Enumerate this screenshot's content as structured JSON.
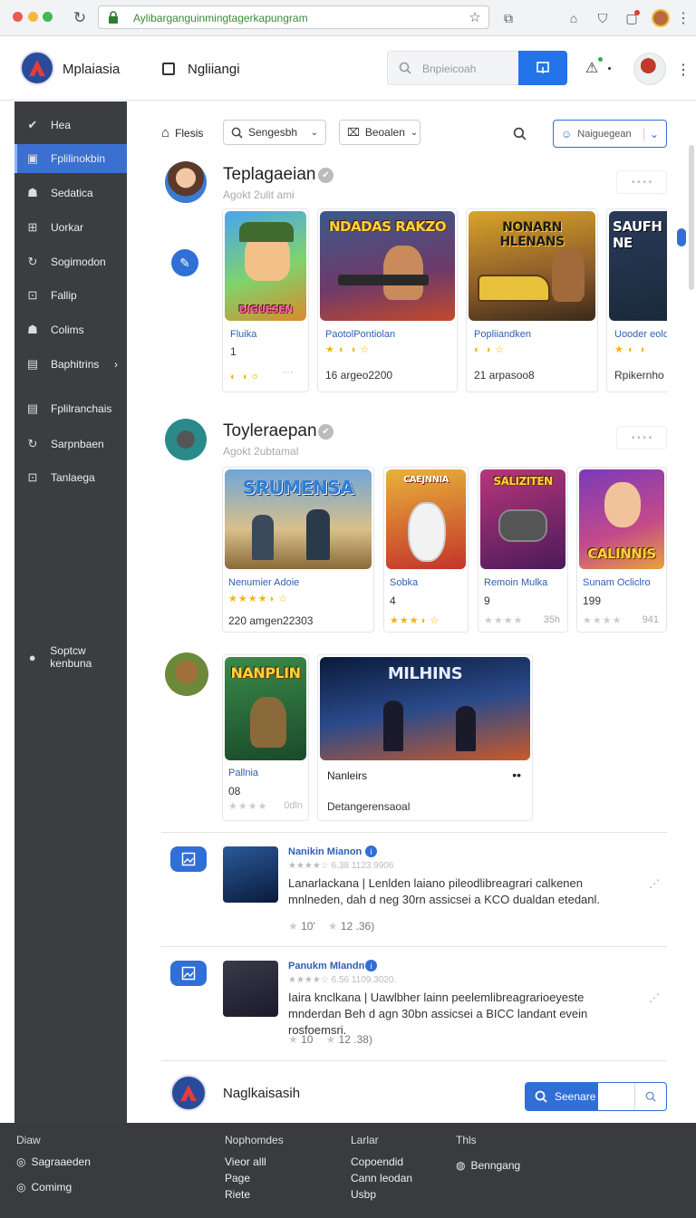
{
  "browser": {
    "url": "Aylibarganguinmingtagerkapungram"
  },
  "header": {
    "app_title": "Mplaiasia",
    "checkbox_label": "Ngliiangi",
    "search_placeholder": "Bnpieicoah"
  },
  "sidebar": {
    "items": [
      {
        "label": "Hea",
        "icon": "check-icon"
      },
      {
        "label": "Fplilinokbin",
        "icon": "display-icon"
      },
      {
        "label": "Sedatica",
        "icon": "person-icon"
      },
      {
        "label": "Uorkar",
        "icon": "grid-icon"
      },
      {
        "label": "Sogimodon",
        "icon": "refresh-icon"
      },
      {
        "label": "Fallip",
        "icon": "image-icon"
      },
      {
        "label": "Colims",
        "icon": "person-icon"
      },
      {
        "label": "Baphitrins",
        "icon": "document-icon"
      },
      {
        "label": "Fplilranchais",
        "icon": "document-icon"
      },
      {
        "label": "Sarpnbaen",
        "icon": "refresh-icon"
      },
      {
        "label": "Tanlaega",
        "icon": "image-icon"
      }
    ],
    "bottom_item": "Soptcw kenbuna"
  },
  "filters": {
    "home_label": "Flesis",
    "dropdown1": "Sengesbh",
    "dropdown2": "Beoalen",
    "user_select": "Naiguegean"
  },
  "section1": {
    "title": "Teplagaeian",
    "subtitle": "Agokt 2ulit ami",
    "cards": [
      {
        "art": "DIGUESEN",
        "name": "Fluika",
        "num": "1",
        "stars": "◐ ◑ ৩",
        "meta": ""
      },
      {
        "art": "NDADAS RAKZO",
        "name": "PaotolPontiolan",
        "num": "",
        "stars": "★ ◐ ◑ ☆",
        "meta": "16 argeo2200"
      },
      {
        "art": "NONARN HLENANS",
        "name": "Popliiandken",
        "num": "",
        "stars": "◐ ◑ ☆",
        "meta": "21 arpasoo8"
      },
      {
        "art": "SAUFH NE",
        "name": "Uooder eold",
        "num": "",
        "stars": "★ ◐ ◑",
        "meta": "Rpikernho"
      }
    ]
  },
  "section2": {
    "title": "Toyleraepan",
    "subtitle": "Agokt 2ubtamal",
    "cards": [
      {
        "art": "SRUMENSA",
        "name": "Nenumier Adoie",
        "num": "",
        "stars": "★★★★◑ ☆",
        "meta": "220 amgen22303"
      },
      {
        "art": "CAEJNNIA",
        "name": "Sobka",
        "num": "4",
        "stars": "★★★◑ ☆",
        "meta": ""
      },
      {
        "art": "SALIZITEN",
        "name": "Remoin Mulka",
        "num": "9",
        "stars": "★★★★",
        "meta": "35h"
      },
      {
        "art": "CALINNIS",
        "name": "Sunam Ocliclro",
        "num": "199",
        "stars": "★★★★",
        "meta": "941"
      }
    ]
  },
  "section3": {
    "cards": [
      {
        "art": "NANPLIN",
        "name": "Pallnia",
        "num": "08",
        "stars": "★★★★",
        "meta": "0dln"
      },
      {
        "art": "MILHINS",
        "name": "Nanleirs",
        "num": "",
        "stars": "",
        "meta": "Detangerensaoal"
      }
    ]
  },
  "reviews": [
    {
      "author": "Nanikin Mianon",
      "rating_meta": "★★★★☆ 6.38 1123.9906",
      "text": "Lanarlackana | Lenlden laiano pileodlibreagrari calkenen mnlneden, dah d neg 30rn assicsei a KCO dualdan etedanl.",
      "likes": "10'",
      "reply": "12 .36)"
    },
    {
      "author": "Panukm Mlandn",
      "rating_meta": "★★★★☆ 6.56 1109.3020.",
      "text": "Iaira knclkana | Uawlbher lainn peelemlibreagrarioeyeste mnderdan Beh d agn 30bn assicsei a BICC landant evein rosfoemsri.",
      "likes": "10",
      "reply": "12 .38)"
    }
  ],
  "bottom_bar": {
    "title": "Naglkaisasih",
    "button": "Seenare"
  },
  "footer": {
    "col1": {
      "title": "Diaw",
      "items": [
        "Sagraaeden",
        "Comimg"
      ]
    },
    "col2": {
      "title": "Nophomdes",
      "items": [
        "Vieor alll",
        "Page",
        "Riete"
      ]
    },
    "col3": {
      "title": "Larlar",
      "items": [
        "Copoendid",
        "Cann leodan",
        "Usbp"
      ]
    },
    "col4": {
      "title": "Thls",
      "items": [
        "Benngang"
      ]
    }
  },
  "colors": {
    "accent": "#2f6fd6",
    "sidebar": "#3c3d3f",
    "footer": "#3a3b3d"
  }
}
